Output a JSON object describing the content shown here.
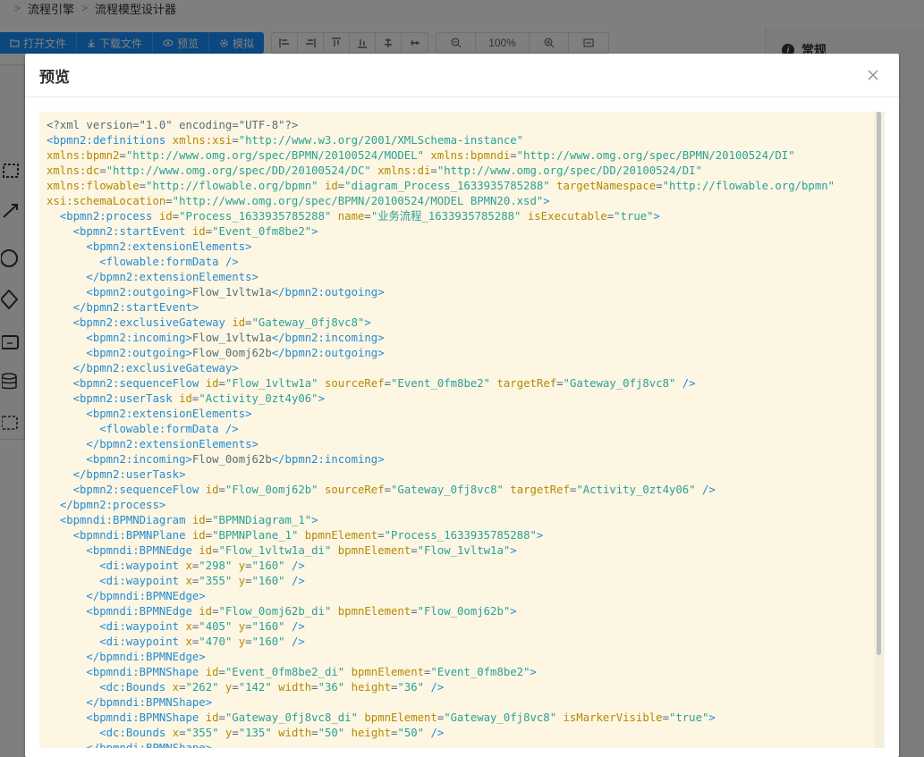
{
  "breadcrumb": {
    "items": [
      "流程引擎",
      "流程模型设计器"
    ]
  },
  "toolbar": {
    "open_file": "打开文件",
    "download_file": "下载文件",
    "preview": "预览",
    "simulate": "模拟",
    "zoom_value": "100%"
  },
  "right_panel": {
    "title": "常规"
  },
  "dialog": {
    "title": "预览",
    "xml_lines": [
      [
        {
          "c": "tx",
          "t": "<?xml version=\"1.0\" encoding=\"UTF-8\"?>"
        }
      ],
      [
        {
          "c": "tg",
          "t": "<bpmn2:definitions "
        },
        {
          "c": "at",
          "t": "xmlns:xsi"
        },
        {
          "c": "tx",
          "t": "="
        },
        {
          "c": "st",
          "t": "\"http://www.w3.org/2001/XMLSchema-instance\""
        }
      ],
      [
        {
          "c": "at",
          "t": "xmlns:bpmn2"
        },
        {
          "c": "tx",
          "t": "="
        },
        {
          "c": "st",
          "t": "\"http://www.omg.org/spec/BPMN/20100524/MODEL\" "
        },
        {
          "c": "at",
          "t": "xmlns:bpmndi"
        },
        {
          "c": "tx",
          "t": "="
        },
        {
          "c": "st",
          "t": "\"http://www.omg.org/spec/BPMN/20100524/DI\""
        }
      ],
      [
        {
          "c": "at",
          "t": "xmlns:dc"
        },
        {
          "c": "tx",
          "t": "="
        },
        {
          "c": "st",
          "t": "\"http://www.omg.org/spec/DD/20100524/DC\" "
        },
        {
          "c": "at",
          "t": "xmlns:di"
        },
        {
          "c": "tx",
          "t": "="
        },
        {
          "c": "st",
          "t": "\"http://www.omg.org/spec/DD/20100524/DI\""
        }
      ],
      [
        {
          "c": "at",
          "t": "xmlns:flowable"
        },
        {
          "c": "tx",
          "t": "="
        },
        {
          "c": "st",
          "t": "\"http://flowable.org/bpmn\" "
        },
        {
          "c": "at",
          "t": "id"
        },
        {
          "c": "tx",
          "t": "="
        },
        {
          "c": "st",
          "t": "\"diagram_Process_1633935785288\" "
        },
        {
          "c": "at",
          "t": "targetNamespace"
        },
        {
          "c": "tx",
          "t": "="
        },
        {
          "c": "st",
          "t": "\"http://flowable.org/bpmn\""
        }
      ],
      [
        {
          "c": "at",
          "t": "xsi:schemaLocation"
        },
        {
          "c": "tx",
          "t": "="
        },
        {
          "c": "st",
          "t": "\"http://www.omg.org/spec/BPMN/20100524/MODEL BPMN20.xsd\""
        },
        {
          "c": "tg",
          "t": ">"
        }
      ],
      [
        {
          "c": "tx",
          "t": "  "
        },
        {
          "c": "tg",
          "t": "<bpmn2:process "
        },
        {
          "c": "at",
          "t": "id"
        },
        {
          "c": "tx",
          "t": "="
        },
        {
          "c": "st",
          "t": "\"Process_1633935785288\" "
        },
        {
          "c": "at",
          "t": "name"
        },
        {
          "c": "tx",
          "t": "="
        },
        {
          "c": "st",
          "t": "\"业务流程_1633935785288\" "
        },
        {
          "c": "at",
          "t": "isExecutable"
        },
        {
          "c": "tx",
          "t": "="
        },
        {
          "c": "st",
          "t": "\"true\""
        },
        {
          "c": "tg",
          "t": ">"
        }
      ],
      [
        {
          "c": "tx",
          "t": "    "
        },
        {
          "c": "tg",
          "t": "<bpmn2:startEvent "
        },
        {
          "c": "at",
          "t": "id"
        },
        {
          "c": "tx",
          "t": "="
        },
        {
          "c": "st",
          "t": "\"Event_0fm8be2\""
        },
        {
          "c": "tg",
          "t": ">"
        }
      ],
      [
        {
          "c": "tx",
          "t": "      "
        },
        {
          "c": "tg",
          "t": "<bpmn2:extensionElements>"
        }
      ],
      [
        {
          "c": "tx",
          "t": "        "
        },
        {
          "c": "tg",
          "t": "<flowable:formData />"
        }
      ],
      [
        {
          "c": "tx",
          "t": "      "
        },
        {
          "c": "tg",
          "t": "</bpmn2:extensionElements>"
        }
      ],
      [
        {
          "c": "tx",
          "t": "      "
        },
        {
          "c": "tg",
          "t": "<bpmn2:outgoing>"
        },
        {
          "c": "tx",
          "t": "Flow_1vltw1a"
        },
        {
          "c": "tg",
          "t": "</bpmn2:outgoing>"
        }
      ],
      [
        {
          "c": "tx",
          "t": "    "
        },
        {
          "c": "tg",
          "t": "</bpmn2:startEvent>"
        }
      ],
      [
        {
          "c": "tx",
          "t": "    "
        },
        {
          "c": "tg",
          "t": "<bpmn2:exclusiveGateway "
        },
        {
          "c": "at",
          "t": "id"
        },
        {
          "c": "tx",
          "t": "="
        },
        {
          "c": "st",
          "t": "\"Gateway_0fj8vc8\""
        },
        {
          "c": "tg",
          "t": ">"
        }
      ],
      [
        {
          "c": "tx",
          "t": "      "
        },
        {
          "c": "tg",
          "t": "<bpmn2:incoming>"
        },
        {
          "c": "tx",
          "t": "Flow_1vltw1a"
        },
        {
          "c": "tg",
          "t": "</bpmn2:incoming>"
        }
      ],
      [
        {
          "c": "tx",
          "t": "      "
        },
        {
          "c": "tg",
          "t": "<bpmn2:outgoing>"
        },
        {
          "c": "tx",
          "t": "Flow_0omj62b"
        },
        {
          "c": "tg",
          "t": "</bpmn2:outgoing>"
        }
      ],
      [
        {
          "c": "tx",
          "t": "    "
        },
        {
          "c": "tg",
          "t": "</bpmn2:exclusiveGateway>"
        }
      ],
      [
        {
          "c": "tx",
          "t": "    "
        },
        {
          "c": "tg",
          "t": "<bpmn2:sequenceFlow "
        },
        {
          "c": "at",
          "t": "id"
        },
        {
          "c": "tx",
          "t": "="
        },
        {
          "c": "st",
          "t": "\"Flow_1vltw1a\" "
        },
        {
          "c": "at",
          "t": "sourceRef"
        },
        {
          "c": "tx",
          "t": "="
        },
        {
          "c": "st",
          "t": "\"Event_0fm8be2\" "
        },
        {
          "c": "at",
          "t": "targetRef"
        },
        {
          "c": "tx",
          "t": "="
        },
        {
          "c": "st",
          "t": "\"Gateway_0fj8vc8\""
        },
        {
          "c": "tg",
          "t": " />"
        }
      ],
      [
        {
          "c": "tx",
          "t": "    "
        },
        {
          "c": "tg",
          "t": "<bpmn2:userTask "
        },
        {
          "c": "at",
          "t": "id"
        },
        {
          "c": "tx",
          "t": "="
        },
        {
          "c": "st",
          "t": "\"Activity_0zt4y06\""
        },
        {
          "c": "tg",
          "t": ">"
        }
      ],
      [
        {
          "c": "tx",
          "t": "      "
        },
        {
          "c": "tg",
          "t": "<bpmn2:extensionElements>"
        }
      ],
      [
        {
          "c": "tx",
          "t": "        "
        },
        {
          "c": "tg",
          "t": "<flowable:formData />"
        }
      ],
      [
        {
          "c": "tx",
          "t": "      "
        },
        {
          "c": "tg",
          "t": "</bpmn2:extensionElements>"
        }
      ],
      [
        {
          "c": "tx",
          "t": "      "
        },
        {
          "c": "tg",
          "t": "<bpmn2:incoming>"
        },
        {
          "c": "tx",
          "t": "Flow_0omj62b"
        },
        {
          "c": "tg",
          "t": "</bpmn2:incoming>"
        }
      ],
      [
        {
          "c": "tx",
          "t": "    "
        },
        {
          "c": "tg",
          "t": "</bpmn2:userTask>"
        }
      ],
      [
        {
          "c": "tx",
          "t": "    "
        },
        {
          "c": "tg",
          "t": "<bpmn2:sequenceFlow "
        },
        {
          "c": "at",
          "t": "id"
        },
        {
          "c": "tx",
          "t": "="
        },
        {
          "c": "st",
          "t": "\"Flow_0omj62b\" "
        },
        {
          "c": "at",
          "t": "sourceRef"
        },
        {
          "c": "tx",
          "t": "="
        },
        {
          "c": "st",
          "t": "\"Gateway_0fj8vc8\" "
        },
        {
          "c": "at",
          "t": "targetRef"
        },
        {
          "c": "tx",
          "t": "="
        },
        {
          "c": "st",
          "t": "\"Activity_0zt4y06\""
        },
        {
          "c": "tg",
          "t": " />"
        }
      ],
      [
        {
          "c": "tx",
          "t": "  "
        },
        {
          "c": "tg",
          "t": "</bpmn2:process>"
        }
      ],
      [
        {
          "c": "tx",
          "t": "  "
        },
        {
          "c": "tg",
          "t": "<bpmndi:BPMNDiagram "
        },
        {
          "c": "at",
          "t": "id"
        },
        {
          "c": "tx",
          "t": "="
        },
        {
          "c": "st",
          "t": "\"BPMNDiagram_1\""
        },
        {
          "c": "tg",
          "t": ">"
        }
      ],
      [
        {
          "c": "tx",
          "t": "    "
        },
        {
          "c": "tg",
          "t": "<bpmndi:BPMNPlane "
        },
        {
          "c": "at",
          "t": "id"
        },
        {
          "c": "tx",
          "t": "="
        },
        {
          "c": "st",
          "t": "\"BPMNPlane_1\" "
        },
        {
          "c": "at",
          "t": "bpmnElement"
        },
        {
          "c": "tx",
          "t": "="
        },
        {
          "c": "st",
          "t": "\"Process_1633935785288\""
        },
        {
          "c": "tg",
          "t": ">"
        }
      ],
      [
        {
          "c": "tx",
          "t": "      "
        },
        {
          "c": "tg",
          "t": "<bpmndi:BPMNEdge "
        },
        {
          "c": "at",
          "t": "id"
        },
        {
          "c": "tx",
          "t": "="
        },
        {
          "c": "st",
          "t": "\"Flow_1vltw1a_di\" "
        },
        {
          "c": "at",
          "t": "bpmnElement"
        },
        {
          "c": "tx",
          "t": "="
        },
        {
          "c": "st",
          "t": "\"Flow_1vltw1a\""
        },
        {
          "c": "tg",
          "t": ">"
        }
      ],
      [
        {
          "c": "tx",
          "t": "        "
        },
        {
          "c": "tg",
          "t": "<di:waypoint "
        },
        {
          "c": "at",
          "t": "x"
        },
        {
          "c": "tx",
          "t": "="
        },
        {
          "c": "st",
          "t": "\"298\" "
        },
        {
          "c": "at",
          "t": "y"
        },
        {
          "c": "tx",
          "t": "="
        },
        {
          "c": "st",
          "t": "\"160\""
        },
        {
          "c": "tg",
          "t": " />"
        }
      ],
      [
        {
          "c": "tx",
          "t": "        "
        },
        {
          "c": "tg",
          "t": "<di:waypoint "
        },
        {
          "c": "at",
          "t": "x"
        },
        {
          "c": "tx",
          "t": "="
        },
        {
          "c": "st",
          "t": "\"355\" "
        },
        {
          "c": "at",
          "t": "y"
        },
        {
          "c": "tx",
          "t": "="
        },
        {
          "c": "st",
          "t": "\"160\""
        },
        {
          "c": "tg",
          "t": " />"
        }
      ],
      [
        {
          "c": "tx",
          "t": "      "
        },
        {
          "c": "tg",
          "t": "</bpmndi:BPMNEdge>"
        }
      ],
      [
        {
          "c": "tx",
          "t": "      "
        },
        {
          "c": "tg",
          "t": "<bpmndi:BPMNEdge "
        },
        {
          "c": "at",
          "t": "id"
        },
        {
          "c": "tx",
          "t": "="
        },
        {
          "c": "st",
          "t": "\"Flow_0omj62b_di\" "
        },
        {
          "c": "at",
          "t": "bpmnElement"
        },
        {
          "c": "tx",
          "t": "="
        },
        {
          "c": "st",
          "t": "\"Flow_0omj62b\""
        },
        {
          "c": "tg",
          "t": ">"
        }
      ],
      [
        {
          "c": "tx",
          "t": "        "
        },
        {
          "c": "tg",
          "t": "<di:waypoint "
        },
        {
          "c": "at",
          "t": "x"
        },
        {
          "c": "tx",
          "t": "="
        },
        {
          "c": "st",
          "t": "\"405\" "
        },
        {
          "c": "at",
          "t": "y"
        },
        {
          "c": "tx",
          "t": "="
        },
        {
          "c": "st",
          "t": "\"160\""
        },
        {
          "c": "tg",
          "t": " />"
        }
      ],
      [
        {
          "c": "tx",
          "t": "        "
        },
        {
          "c": "tg",
          "t": "<di:waypoint "
        },
        {
          "c": "at",
          "t": "x"
        },
        {
          "c": "tx",
          "t": "="
        },
        {
          "c": "st",
          "t": "\"470\" "
        },
        {
          "c": "at",
          "t": "y"
        },
        {
          "c": "tx",
          "t": "="
        },
        {
          "c": "st",
          "t": "\"160\""
        },
        {
          "c": "tg",
          "t": " />"
        }
      ],
      [
        {
          "c": "tx",
          "t": "      "
        },
        {
          "c": "tg",
          "t": "</bpmndi:BPMNEdge>"
        }
      ],
      [
        {
          "c": "tx",
          "t": "      "
        },
        {
          "c": "tg",
          "t": "<bpmndi:BPMNShape "
        },
        {
          "c": "at",
          "t": "id"
        },
        {
          "c": "tx",
          "t": "="
        },
        {
          "c": "st",
          "t": "\"Event_0fm8be2_di\" "
        },
        {
          "c": "at",
          "t": "bpmnElement"
        },
        {
          "c": "tx",
          "t": "="
        },
        {
          "c": "st",
          "t": "\"Event_0fm8be2\""
        },
        {
          "c": "tg",
          "t": ">"
        }
      ],
      [
        {
          "c": "tx",
          "t": "        "
        },
        {
          "c": "tg",
          "t": "<dc:Bounds "
        },
        {
          "c": "at",
          "t": "x"
        },
        {
          "c": "tx",
          "t": "="
        },
        {
          "c": "st",
          "t": "\"262\" "
        },
        {
          "c": "at",
          "t": "y"
        },
        {
          "c": "tx",
          "t": "="
        },
        {
          "c": "st",
          "t": "\"142\" "
        },
        {
          "c": "at",
          "t": "width"
        },
        {
          "c": "tx",
          "t": "="
        },
        {
          "c": "st",
          "t": "\"36\" "
        },
        {
          "c": "at",
          "t": "height"
        },
        {
          "c": "tx",
          "t": "="
        },
        {
          "c": "st",
          "t": "\"36\""
        },
        {
          "c": "tg",
          "t": " />"
        }
      ],
      [
        {
          "c": "tx",
          "t": "      "
        },
        {
          "c": "tg",
          "t": "</bpmndi:BPMNShape>"
        }
      ],
      [
        {
          "c": "tx",
          "t": "      "
        },
        {
          "c": "tg",
          "t": "<bpmndi:BPMNShape "
        },
        {
          "c": "at",
          "t": "id"
        },
        {
          "c": "tx",
          "t": "="
        },
        {
          "c": "st",
          "t": "\"Gateway_0fj8vc8_di\" "
        },
        {
          "c": "at",
          "t": "bpmnElement"
        },
        {
          "c": "tx",
          "t": "="
        },
        {
          "c": "st",
          "t": "\"Gateway_0fj8vc8\" "
        },
        {
          "c": "at",
          "t": "isMarkerVisible"
        },
        {
          "c": "tx",
          "t": "="
        },
        {
          "c": "st",
          "t": "\"true\""
        },
        {
          "c": "tg",
          "t": ">"
        }
      ],
      [
        {
          "c": "tx",
          "t": "        "
        },
        {
          "c": "tg",
          "t": "<dc:Bounds "
        },
        {
          "c": "at",
          "t": "x"
        },
        {
          "c": "tx",
          "t": "="
        },
        {
          "c": "st",
          "t": "\"355\" "
        },
        {
          "c": "at",
          "t": "y"
        },
        {
          "c": "tx",
          "t": "="
        },
        {
          "c": "st",
          "t": "\"135\" "
        },
        {
          "c": "at",
          "t": "width"
        },
        {
          "c": "tx",
          "t": "="
        },
        {
          "c": "st",
          "t": "\"50\" "
        },
        {
          "c": "at",
          "t": "height"
        },
        {
          "c": "tx",
          "t": "="
        },
        {
          "c": "st",
          "t": "\"50\""
        },
        {
          "c": "tg",
          "t": " />"
        }
      ],
      [
        {
          "c": "tx",
          "t": "      "
        },
        {
          "c": "tg",
          "t": "</bpmndi:BPMNShape>"
        }
      ]
    ]
  },
  "colors": {
    "primary": "#1890ff",
    "code_bg": "#fdf6e3",
    "tag": "#268bd2",
    "attr": "#b58900",
    "string": "#2aa198"
  },
  "icons": [
    "folder-open-icon",
    "download-icon",
    "eye-icon",
    "gear-icon",
    "align-left-icon",
    "align-right-icon",
    "align-top-icon",
    "align-bottom-icon",
    "align-center-icon",
    "align-middle-icon",
    "zoom-out-icon",
    "zoom-in-icon",
    "fit-icon",
    "close-icon",
    "info-icon"
  ]
}
